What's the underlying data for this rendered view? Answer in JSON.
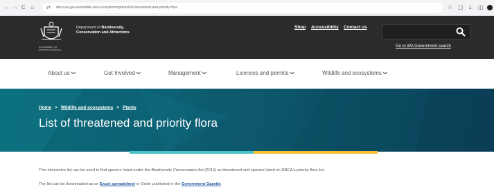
{
  "browser": {
    "back": "←",
    "forward": "→",
    "reload": "C",
    "home": "⌂",
    "tune": "⇄",
    "url": "dbca.wa.gov.au/wildlife-and-ecosystems/plants/list-threatened-and-priority-flora",
    "star": "☆",
    "extensions": "▢",
    "download": "⤓",
    "sidepanel": "◫"
  },
  "header": {
    "gov_label": "GOVERNMENT OF WESTERN AUSTRALIA",
    "dept_line1_prefix": "Department of ",
    "dept_line1_bold": "Biodiversity,",
    "dept_line2": "Conservation and Attractions",
    "links": [
      "Shop",
      "Accessibility",
      "Contact us"
    ],
    "search_placeholder": "",
    "gov_search_link": "Go to WA Government search"
  },
  "nav": [
    "About us",
    "Get Involved",
    "Management",
    "Licences and permits",
    "Wildlife and ecosystems"
  ],
  "banner": {
    "breadcrumb": [
      "Home",
      "Wildlife and ecosystems",
      "Plants"
    ],
    "title": "List of threatened and priority flora"
  },
  "content": {
    "p1_before": "This interactive list can be used to find species listed under the ",
    "p1_italic": "Biodiversity Conservation Act (2016)",
    "p1_after": " as threatened and species listed on DBCA's priority flora list.",
    "p2_before": "The list can be downloaded as an ",
    "p2_link1": "Excel spreadsheet",
    "p2_mid": " or Order published in the ",
    "p2_link2": "Government Gazette",
    "p2_end": "."
  },
  "colors": {
    "header_bg": "#2b2b2b",
    "banner": "#0b5a6e",
    "stripe_teal": "#4ac1c8",
    "stripe_yellow": "#f2c230",
    "link": "#1b4f9c"
  }
}
